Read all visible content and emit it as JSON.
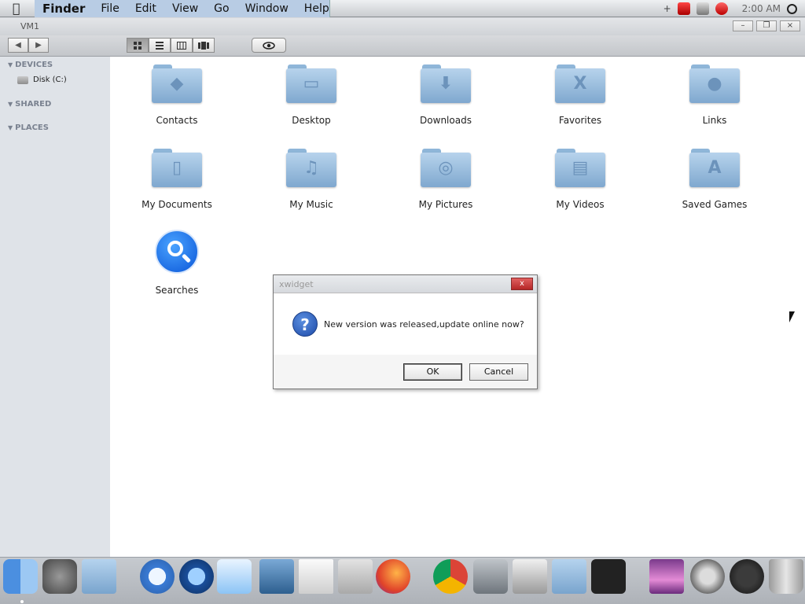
{
  "menubar": {
    "apple": "",
    "menus": [
      "Finder",
      "File",
      "Edit",
      "View",
      "Go",
      "Window",
      "Help"
    ],
    "clock": "2:00 AM"
  },
  "window": {
    "title": "VM1",
    "minimize": "–",
    "restore": "❐",
    "close": "×"
  },
  "toolbar": {
    "back": "◀",
    "forward": "▶"
  },
  "sidebar": {
    "devices": "DEVICES",
    "disk": "Disk (C:)",
    "shared": "SHARED",
    "places": "PLACES"
  },
  "folders": [
    {
      "label": "Contacts",
      "glyph": "◆"
    },
    {
      "label": "Desktop",
      "glyph": "▭"
    },
    {
      "label": "Downloads",
      "glyph": "⬇"
    },
    {
      "label": "Favorites",
      "glyph": "X"
    },
    {
      "label": "Links",
      "glyph": "●"
    },
    {
      "label": "My Documents",
      "glyph": "▯"
    },
    {
      "label": "My Music",
      "glyph": "♫"
    },
    {
      "label": "My Pictures",
      "glyph": "◎"
    },
    {
      "label": "My Videos",
      "glyph": "▤"
    },
    {
      "label": "Saved Games",
      "glyph": "A"
    },
    {
      "label": "Searches",
      "glyph": ""
    }
  ],
  "dialog": {
    "title": "xwidget",
    "close": "x",
    "message": "New version was released,update online now?",
    "icon": "?",
    "ok": "OK",
    "cancel": "Cancel"
  },
  "dock": {
    "items": [
      "finder-icon",
      "system-preferences-icon",
      "users-folder-icon",
      "safari-icon",
      "quicktime-icon",
      "word-icon",
      "iphoto-icon",
      "textedit-icon",
      "calculator-icon",
      "firefox-icon",
      "chrome-icon",
      "app-store-icon",
      "system-utility-icon",
      "library-folder-icon",
      "widgets-icon",
      "desktop-preview-icon",
      "launchpad-icon",
      "power-icon",
      "trash-icon"
    ]
  }
}
